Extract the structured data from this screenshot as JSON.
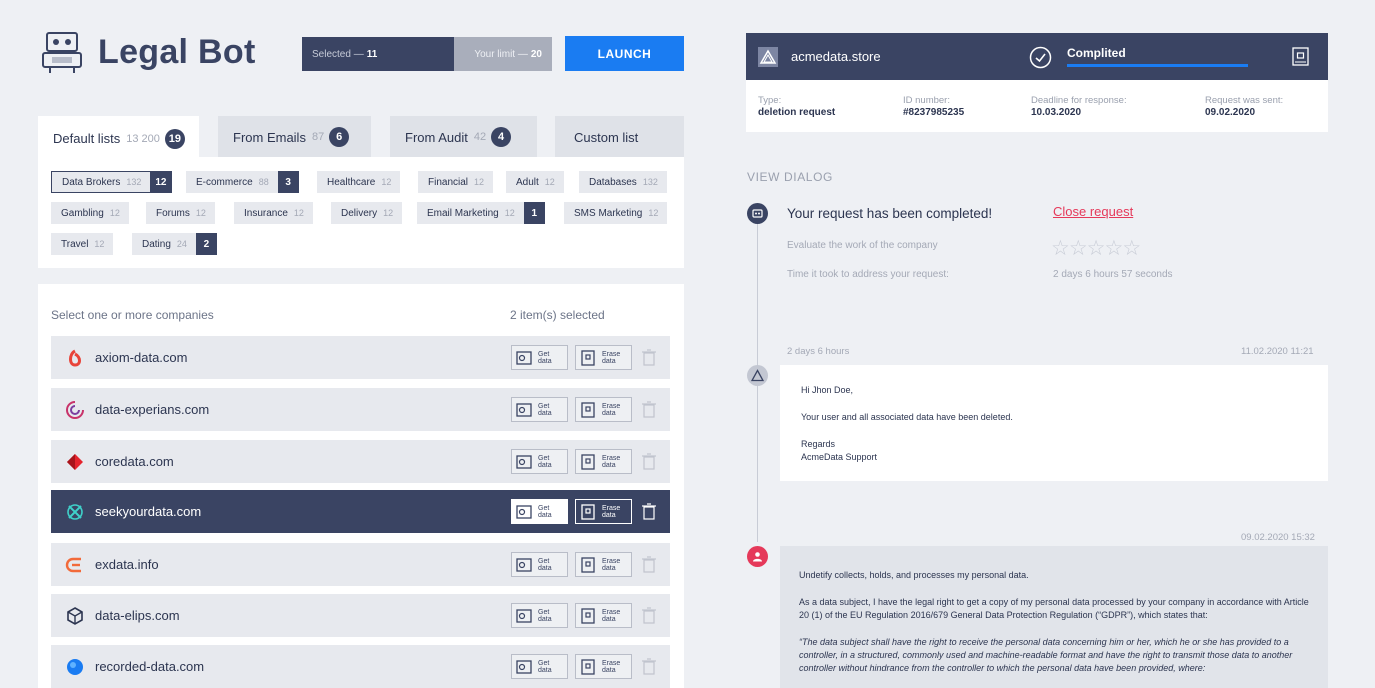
{
  "app": {
    "title": "Legal Bot"
  },
  "limits": {
    "selected_label": "Selected —",
    "selected_value": "11",
    "limit_label": "Your limit —",
    "limit_value": "20",
    "launch": "LAUNCH"
  },
  "tabs": [
    {
      "label": "Default lists",
      "count": "13 200",
      "badge": "19"
    },
    {
      "label": "From Emails",
      "count": "87",
      "badge": "6"
    },
    {
      "label": "From Audit",
      "count": "42",
      "badge": "4"
    },
    {
      "label": "Custom list",
      "count": "",
      "badge": ""
    }
  ],
  "categories": [
    {
      "label": "Data Brokers",
      "count": "132",
      "badge": "12"
    },
    {
      "label": "E-commerce",
      "count": "88",
      "badge": "3"
    },
    {
      "label": "Healthcare",
      "count": "12",
      "badge": ""
    },
    {
      "label": "Financial",
      "count": "12",
      "badge": ""
    },
    {
      "label": "Adult",
      "count": "12",
      "badge": ""
    },
    {
      "label": "Databases",
      "count": "132",
      "badge": ""
    },
    {
      "label": "Gambling",
      "count": "12",
      "badge": ""
    },
    {
      "label": "Forums",
      "count": "12",
      "badge": ""
    },
    {
      "label": "Insurance",
      "count": "12",
      "badge": ""
    },
    {
      "label": "Delivery",
      "count": "12",
      "badge": ""
    },
    {
      "label": "Email Marketing",
      "count": "12",
      "badge": "1"
    },
    {
      "label": "SMS Marketing",
      "count": "12",
      "badge": ""
    },
    {
      "label": "Travel",
      "count": "12",
      "badge": ""
    },
    {
      "label": "Dating",
      "count": "24",
      "badge": "2"
    }
  ],
  "companies_panel": {
    "hint": "Select one or more companies",
    "selected_count": "2 item(s) selected",
    "get_line1": "Get",
    "get_line2": "data",
    "erase_line1": "Erase",
    "erase_line2": "data"
  },
  "companies": [
    {
      "name": "axiom-data.com"
    },
    {
      "name": "data-experians.com"
    },
    {
      "name": "coredata.com"
    },
    {
      "name": "seekyourdata.com"
    },
    {
      "name": "exdata.info"
    },
    {
      "name": "data-elips.com"
    },
    {
      "name": "recorded-data.com"
    }
  ],
  "request": {
    "domain": "acmedata.store",
    "status": "Complited",
    "progress": 1.0,
    "type_label": "Type:",
    "type_value": "deletion request",
    "id_label": "ID number:",
    "id_value": "#8237985235",
    "deadline_label": "Deadline for response:",
    "deadline_value": "10.03.2020",
    "sent_label": "Request was sent:",
    "sent_value": "09.02.2020"
  },
  "dialog": {
    "heading": "VIEW DIALOG",
    "completed_msg": "Your request has been completed!",
    "close_link": "Close request",
    "evaluate": "Evaluate the work of the company",
    "rating": 0,
    "time_label": "Time it took to address your request:",
    "time_value": "2  days 6 hours 57 seconds",
    "reply_elapsed": "2  days 6 hours",
    "reply_date": "11.02.2020 11:21",
    "reply": {
      "greeting": "Hi Jhon Doe,",
      "body": "Your user and all associated data have been deleted.",
      "regards": "Regards",
      "signature": "AcmeData Support"
    },
    "sent_date": "09.02.2020 15:32",
    "sent": {
      "p1": "Undetify collects, holds, and processes my personal data.",
      "p2": "As a data subject, I have the legal right to get a copy of my personal data processed by your company in accordance with Article 20 (1) of the EU Regulation 2016/679 General Data Protection Regulation (“GDPR”), which states that:",
      "p3": "“The data subject shall have the right to receive the personal data concerning him or her, which he or she has provided to a controller, in a structured, commonly used and machine-readable format and have the right to transmit those data to another controller without hindrance from the controller to which the personal data have been provided, where:"
    }
  },
  "colors": {
    "navy": "#3a4463",
    "accent": "#1a7cf2",
    "danger": "#e5395a",
    "bg": "#eef0f4"
  }
}
